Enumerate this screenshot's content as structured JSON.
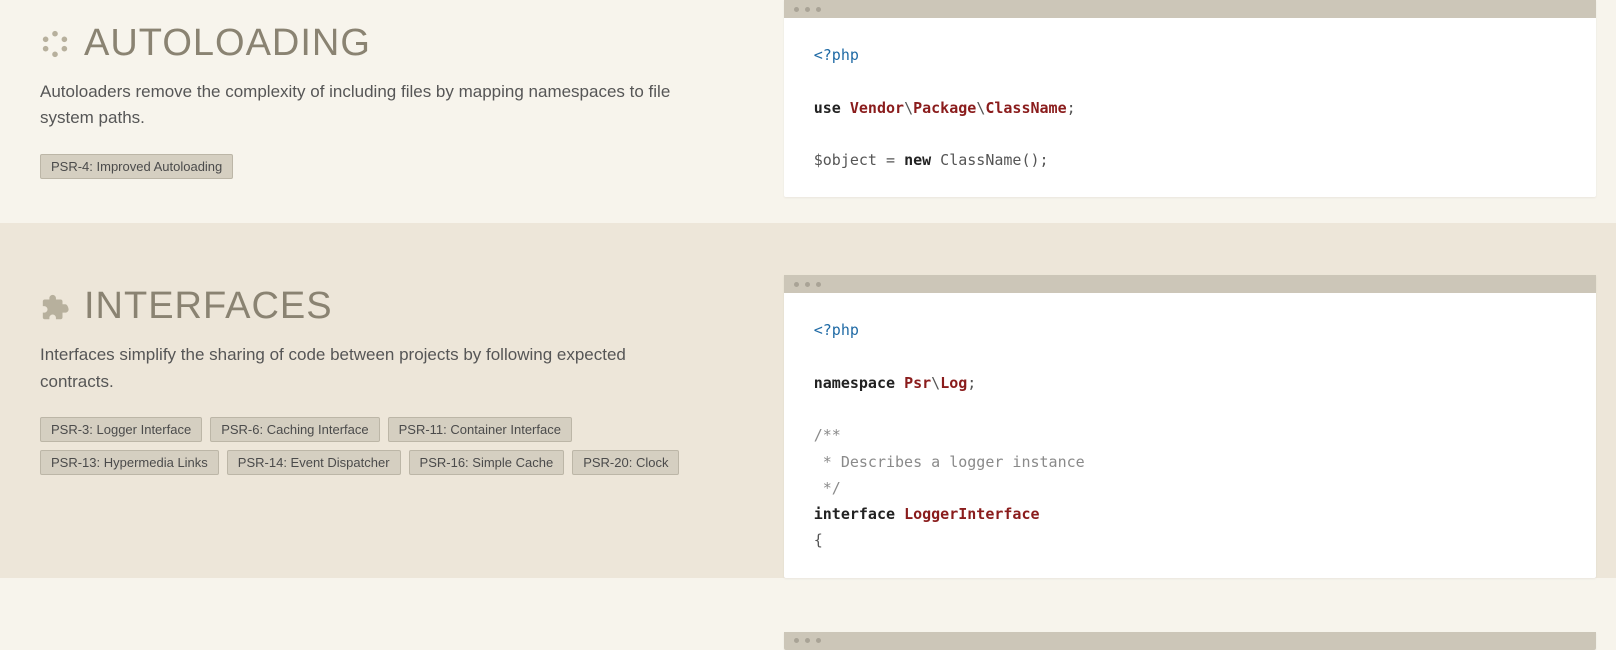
{
  "autoloading": {
    "title": "AUTOLOADING",
    "description": "Autoloaders remove the complexity of including files by mapping namespaces to file system paths.",
    "tags": [
      "PSR-4: Improved Autoloading"
    ],
    "code": {
      "open": "<?php",
      "kw_use": "use",
      "ns1": "Vendor",
      "ns2": "Package",
      "ns3": "ClassName",
      "var": "$object",
      "eq": " = ",
      "kw_new": "new",
      "call": " ClassName();"
    }
  },
  "interfaces": {
    "title": "INTERFACES",
    "description": "Interfaces simplify the sharing of code between projects by following expected contracts.",
    "tags": [
      "PSR-3: Logger Interface",
      "PSR-6: Caching Interface",
      "PSR-11: Container Interface",
      "PSR-13: Hypermedia Links",
      "PSR-14: Event Dispatcher",
      "PSR-16: Simple Cache",
      "PSR-20: Clock"
    ],
    "code": {
      "open": "<?php",
      "kw_namespace": "namespace",
      "ns1": "Psr",
      "ns2": "Log",
      "comment1": "/**",
      "comment2": " * Describes a logger instance",
      "comment3": " */",
      "kw_interface": "interface",
      "name": "LoggerInterface",
      "brace": "{"
    }
  }
}
